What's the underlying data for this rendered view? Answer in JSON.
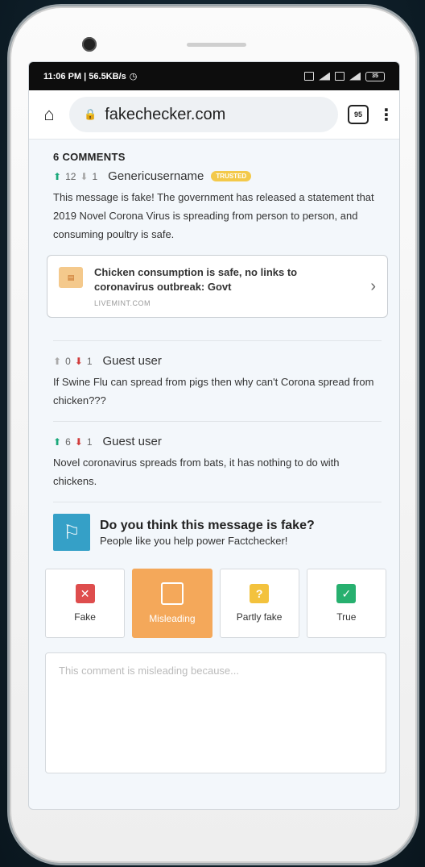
{
  "status_bar": {
    "time_speed": "11:06 PM | 56.5KB/s",
    "battery": "35"
  },
  "browser": {
    "url": "fakechecker.com",
    "tab_count": "95"
  },
  "comments": {
    "title": "6 COMMENTS",
    "items": [
      {
        "upvotes": "12",
        "downvotes": "1",
        "author": "Genericusername",
        "badge": "TRUSTED",
        "text": "This message is fake! The government has released a statement that 2019 Novel Corona Virus is spreading from person to person, and consuming poultry is safe.",
        "link": {
          "title": "Chicken consumption is safe, no links to coronavirus outbreak: Govt",
          "source": "LIVEMINT.COM"
        }
      },
      {
        "upvotes": "0",
        "downvotes": "1",
        "author": "Guest user",
        "text": "If Swine Flu can spread from pigs then why can't Corona spread from chicken???"
      },
      {
        "upvotes": "6",
        "downvotes": "1",
        "author": "Guest user",
        "text": "Novel coronavirus spreads from bats, it has nothing to do with chickens."
      }
    ]
  },
  "prompt": {
    "title": "Do you think this message is fake?",
    "subtitle": "People like you help power Factchecker!"
  },
  "choices": [
    {
      "label": "Fake",
      "icon": "x-icon"
    },
    {
      "label": "Misleading",
      "icon": "exclamation-icon",
      "selected": true
    },
    {
      "label": "Partly fake",
      "icon": "question-icon"
    },
    {
      "label": "True",
      "icon": "check-icon"
    }
  ],
  "comment_box": {
    "placeholder": "This comment is misleading because..."
  },
  "colors": {
    "accent_blue": "#35a0c7",
    "selected_orange": "#f4a85a",
    "upvote_green": "#1aa87a",
    "downvote_red": "#d13c3c"
  }
}
